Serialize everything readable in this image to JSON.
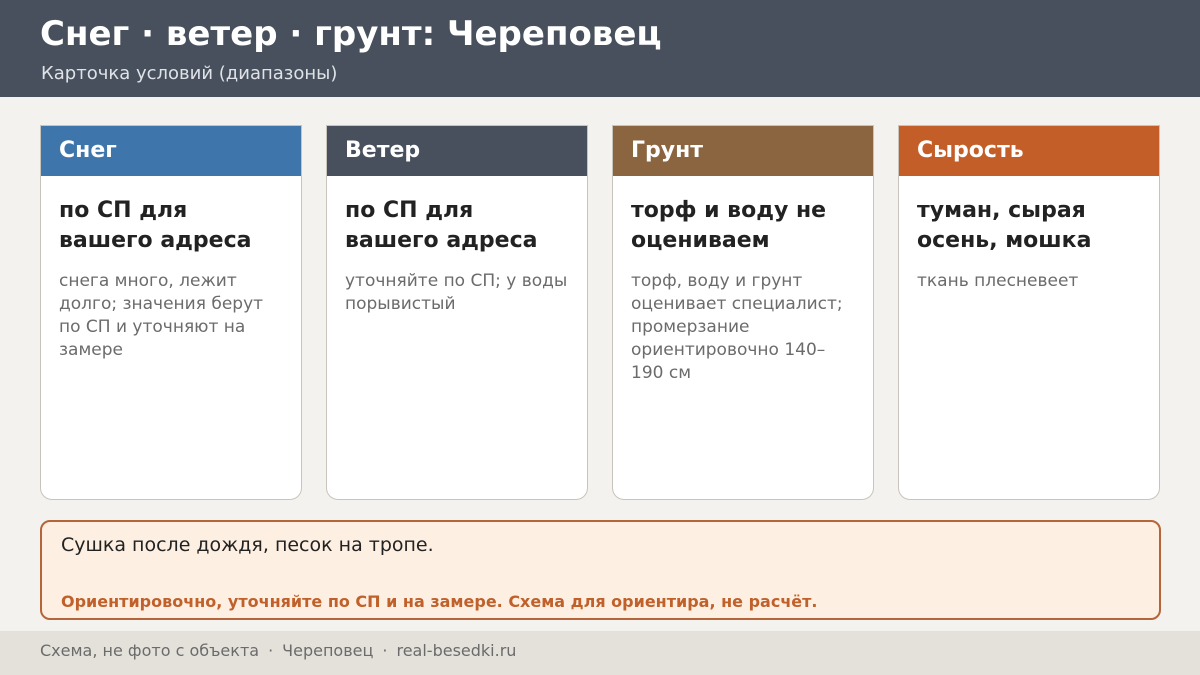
{
  "header": {
    "title": "Снег · ветер · грунт: Череповец",
    "subtitle": "Карточка условий (диапазоны)"
  },
  "cards": [
    {
      "heading": "Снег",
      "main": "по СП для вашего адреса",
      "description": "снега много, лежит долго; значения берут по СП и уточняют на замере",
      "color": "#3e76ab"
    },
    {
      "heading": "Ветер",
      "main": "по СП для вашего адреса",
      "description": "уточняйте по СП; у воды порывистый",
      "color": "#47505c"
    },
    {
      "heading": "Грунт",
      "main": "торф и воду не оцениваем",
      "description": "торф, воду и грунт оценивает специалист; промерзание ориентировочно 140–190 см",
      "color": "#8b6540"
    },
    {
      "heading": "Сырость",
      "main": "туман, сырая осень, мошка",
      "description": "ткань плесневеет",
      "color": "#c45e28"
    }
  ],
  "note": {
    "text": "Сушка после дождя, песок на тропе.",
    "warning": "Ориентировочно, уточняйте по СП и на замере. Схема для ориентира, не расчёт."
  },
  "footer": {
    "items": [
      "Схема, не фото с объекта",
      "Череповец",
      "real-besedki.ru"
    ],
    "separator": "·"
  }
}
